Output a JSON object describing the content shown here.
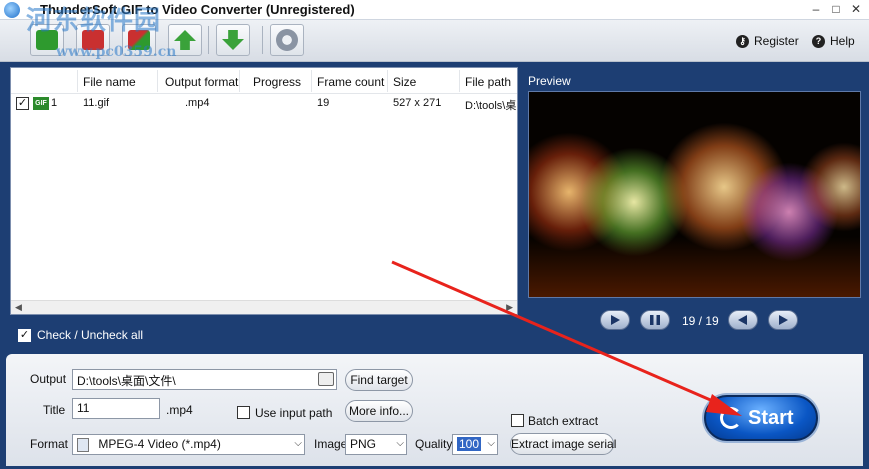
{
  "window": {
    "title": "ThunderSoft GIF to Video Converter (Unregistered)",
    "watermark_line1": "河东软件园",
    "watermark_line2": "www.pc0359.cn"
  },
  "toolbar": {
    "buttons": [
      "add-file",
      "remove-file",
      "clear-list",
      "move-up",
      "move-down",
      "settings"
    ],
    "register_label": "Register",
    "help_label": "Help"
  },
  "file_list": {
    "columns": [
      "File name",
      "Output format",
      "Progress",
      "Frame count",
      "Size",
      "File path"
    ],
    "rows": [
      {
        "index": "1",
        "file_name": "11.gif",
        "output_format": ".mp4",
        "progress": "",
        "frame_count": "19",
        "size": "527 x 271",
        "file_path": "D:\\tools\\桌",
        "checked": true
      }
    ],
    "check_all_label": "Check / Uncheck all"
  },
  "preview": {
    "label": "Preview",
    "frame_counter": "19 / 19"
  },
  "settings": {
    "output_label": "Output",
    "output_value": "D:\\tools\\桌面\\文件\\",
    "find_target_label": "Find target",
    "title_label": "Title",
    "title_value": "11",
    "title_ext": ".mp4",
    "use_input_path_label": "Use input path",
    "more_info_label": "More info...",
    "batch_extract_label": "Batch extract",
    "format_label": "Format",
    "format_value": "MPEG-4 Video (*.mp4)",
    "image_label": "Image",
    "image_value": "PNG",
    "quality_label": "Quality",
    "quality_value": "100",
    "extract_serial_label": "Extract image serial",
    "start_label": "Start"
  },
  "colors": {
    "main_bg": "#1d3e73",
    "start_blue": "#0a56c4",
    "annotation_red": "#e8231c"
  }
}
